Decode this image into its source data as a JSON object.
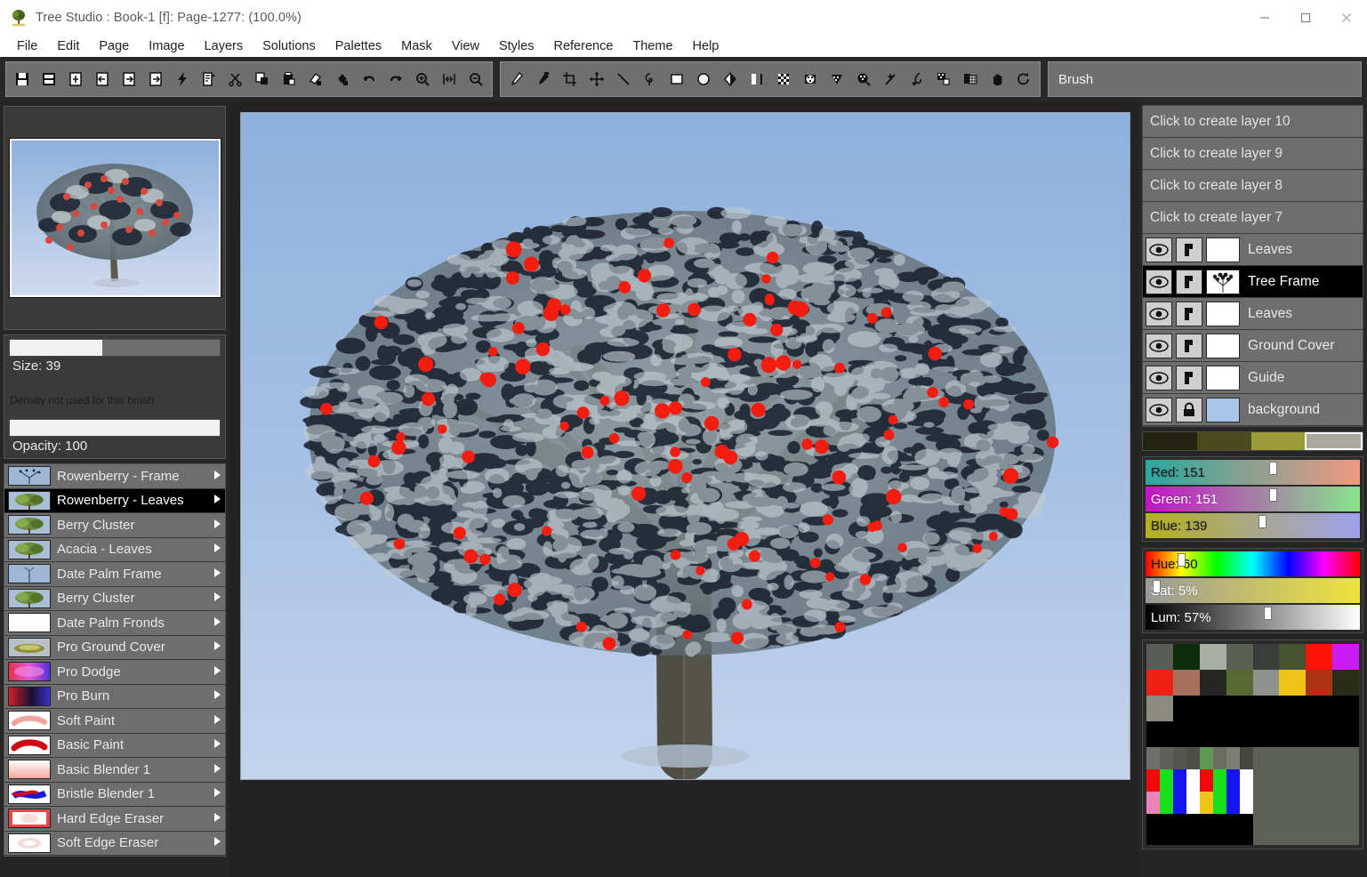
{
  "window": {
    "title": "Tree Studio : Book-1 [f]: Page-1277:  (100.0%)",
    "app_icon": "tree-app-icon",
    "minimize": "minimize-icon",
    "maximize": "maximize-icon",
    "close": "close-icon"
  },
  "menubar": {
    "items": [
      "File",
      "Edit",
      "Page",
      "Image",
      "Layers",
      "Solutions",
      "Palettes",
      "Mask",
      "View",
      "Styles",
      "Reference",
      "Theme",
      "Help"
    ]
  },
  "toolbar1": {
    "icons": [
      "save-icon",
      "save-all-icon",
      "page-new-icon",
      "page-prev-icon",
      "page-next-icon",
      "page-duplicate-icon",
      "lightning-icon",
      "properties-icon",
      "scissors-icon",
      "copy-icon",
      "paste-icon",
      "eraser-stamp-icon",
      "fill-stamp-icon",
      "undo-icon",
      "redo-icon",
      "zoom-in-icon",
      "fit-width-icon",
      "zoom-out-icon"
    ]
  },
  "toolbar2": {
    "icons": [
      "brush-icon",
      "eyedropper-icon",
      "crop-icon",
      "move-icon",
      "line-icon",
      "lasso-icon",
      "rectangle-icon",
      "ellipse-icon",
      "fill-bucket-icon",
      "gradient-icon",
      "checker-pattern-icon",
      "dither-icon",
      "mask-icon",
      "pattern-select-icon",
      "sparkle-wand-icon",
      "smudge-icon",
      "layer-copy-icon",
      "grid-paste-icon",
      "hand-icon",
      "rotate-icon"
    ]
  },
  "brush_field": {
    "value": "Brush"
  },
  "brush_settings": {
    "size_label": "Size: 39",
    "size_percent": 44,
    "density_note": "Density not used for this brush",
    "opacity_label": "Opacity: 100",
    "opacity_percent": 100
  },
  "brush_list": [
    {
      "label": "Rowenberry - Frame",
      "thumb": "frame-sparse-tree",
      "selected": false
    },
    {
      "label": "Rowenberry - Leaves",
      "thumb": "leafy-green-tree",
      "selected": true
    },
    {
      "label": "Berry Cluster",
      "thumb": "leafy-green-tree",
      "selected": false
    },
    {
      "label": "Acacia - Leaves",
      "thumb": "leafy-green-tree",
      "selected": false
    },
    {
      "label": "Date Palm Frame",
      "thumb": "pale-blue-frame",
      "selected": false
    },
    {
      "label": "Berry Cluster",
      "thumb": "leafy-green-tree",
      "selected": false
    },
    {
      "label": "Date Palm Fronds",
      "thumb": "white-blank",
      "selected": false
    },
    {
      "label": "Pro Ground Cover",
      "thumb": "olive-ground",
      "selected": false
    },
    {
      "label": "Pro Dodge",
      "thumb": "magenta-dodge",
      "selected": false
    },
    {
      "label": "Pro Burn",
      "thumb": "dark-burn",
      "selected": false
    },
    {
      "label": "Soft Paint",
      "thumb": "soft-red-stroke",
      "selected": false
    },
    {
      "label": "Basic Paint",
      "thumb": "hard-red-stroke",
      "selected": false
    },
    {
      "label": "Basic Blender 1",
      "thumb": "pink-blend",
      "selected": false
    },
    {
      "label": "Bristle Blender 1",
      "thumb": "red-blue-bristle",
      "selected": false
    },
    {
      "label": "Hard Edge Eraser",
      "thumb": "hard-eraser",
      "selected": false
    },
    {
      "label": "Soft Edge Eraser",
      "thumb": "soft-eraser",
      "selected": false
    }
  ],
  "layers": {
    "create_slots": [
      "Click to create layer 10",
      "Click to create layer 9",
      "Click to create layer 8",
      "Click to create layer 7"
    ],
    "rows": [
      {
        "name": "Leaves",
        "visible": true,
        "locked": false,
        "selected": false,
        "thumb": "#ffffff"
      },
      {
        "name": "Tree Frame",
        "visible": true,
        "locked": false,
        "selected": true,
        "thumb": "tree-frame-thumb"
      },
      {
        "name": "Leaves",
        "visible": true,
        "locked": false,
        "selected": false,
        "thumb": "#ffffff"
      },
      {
        "name": "Ground Cover",
        "visible": true,
        "locked": false,
        "selected": false,
        "thumb": "#ffffff"
      },
      {
        "name": "Guide",
        "visible": true,
        "locked": false,
        "selected": false,
        "thumb": "#ffffff"
      },
      {
        "name": "background",
        "visible": true,
        "locked": true,
        "selected": false,
        "thumb": "#a9c6ea"
      }
    ]
  },
  "recent_swatches": [
    "#22240f",
    "#4a4a1c",
    "#9a9c3c",
    "#a9a99c"
  ],
  "recent_selected_index": 3,
  "color_sliders": {
    "rgb": [
      {
        "label": "Red: 151",
        "value": 151,
        "max": 255,
        "from": "#2aa8a0",
        "to": "#f09880",
        "text_color": "#1a1a1a"
      },
      {
        "label": "Green: 151",
        "value": 151,
        "max": 255,
        "from": "#c413c4",
        "to": "#87e58b",
        "text_color": "#ffffff"
      },
      {
        "label": "Blue: 139",
        "value": 139,
        "max": 255,
        "from": "#b5b020",
        "to": "#9ea0ee",
        "text_color": "#1a1a1a"
      }
    ],
    "hsl": [
      {
        "label": "Hue: 60",
        "value": 60,
        "max": 360,
        "type": "hue",
        "text_color": "#1a1a1a"
      },
      {
        "label": "Sat: 5%",
        "value": 5,
        "max": 100,
        "from": "#9a9a9a",
        "to": "#efe43c",
        "text_color": "#ffffff"
      },
      {
        "label": "Lum: 57%",
        "value": 57,
        "max": 100,
        "from": "#000000",
        "to": "#ffffff",
        "text_color": "#ffffff"
      }
    ]
  },
  "palette": {
    "row1": [
      "#595c57",
      "#0d2d0c",
      "#a8aea3",
      "#5a6052",
      "#3b3d3a",
      "#475230",
      "#fa1408",
      "#cb1bf2"
    ],
    "row2": [
      "#ee2113",
      "#a8705e",
      "#262624",
      "#586a31",
      "#8f918c",
      "#f0c319",
      "#ab3412",
      "#2a2d15"
    ],
    "row3": [
      "#8b8b82",
      "#000000",
      "#000000",
      "#000000",
      "#000000",
      "#000000",
      "#000000",
      "#000000"
    ],
    "row4": [
      "#000000",
      "#000000",
      "#000000",
      "#000000",
      "#000000",
      "#000000",
      "#000000",
      "#000000"
    ],
    "row5": [
      "#6d6f6a",
      "#5f6159",
      "#55574f",
      "#4d4f48",
      "#5e9a55",
      "#6b6d63",
      "#7d7f75",
      "#44463f"
    ],
    "row6": [
      "#f20a0a",
      "#19e01d",
      "#1414ec",
      "#ffffff",
      "#f20a0a",
      "#19e01d",
      "#1414ec",
      "#ffffff"
    ],
    "row7": [
      "#ea84bb",
      "#19e01d",
      "#1414ec",
      "#ffffff",
      "#f2c41a",
      "#19e01d",
      "#1414ec",
      "#ffffff"
    ],
    "row8": [
      "#000000",
      "#000000",
      "#000000",
      "#000000"
    ],
    "filler": "#5d6057"
  },
  "canvas": {
    "sky_top": "#8fb0dd",
    "sky_bottom": "#c3d4ec",
    "trunk_color": "#6c6b5e",
    "berry_color": "#f51c10",
    "foliage_dark": "#1f2634",
    "foliage_light": "#b8c2c8"
  }
}
